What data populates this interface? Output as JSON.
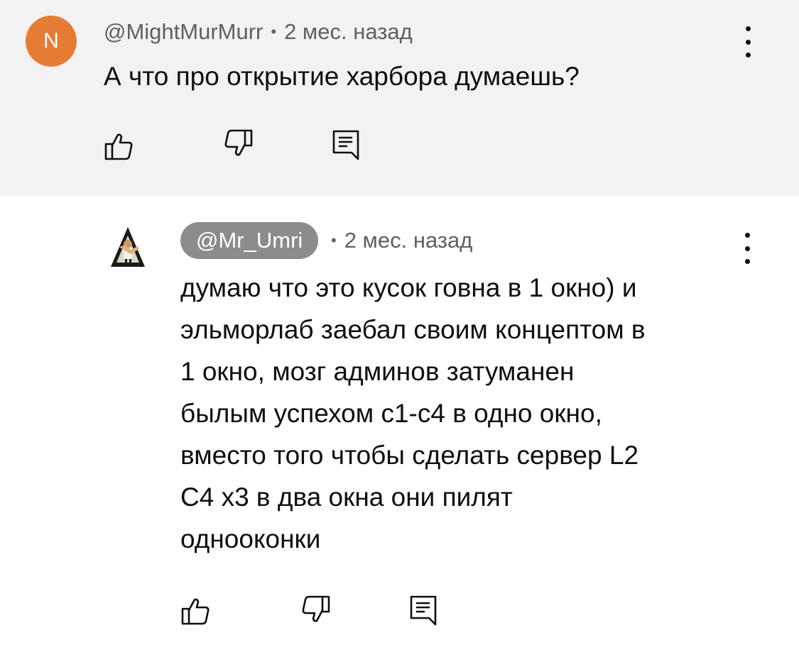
{
  "comments": [
    {
      "author": "@MightMurMurr",
      "avatar_letter": "N",
      "avatar_color": "#e57c35",
      "separator": "•",
      "time": "2 мес. назад",
      "text": "А что про открытие харбора думаешь?"
    },
    {
      "author": "@Mr_Umri",
      "author_chip_color": "#8c8c8c",
      "separator": "•",
      "time": "2 мес. назад",
      "text_lines": [
        "думаю что это кусок говна в 1 окно) и",
        "эльморлаб заебал своим концептом в",
        "1 окно, мозг админов затуманен",
        "былым успехом с1-с4 в одно окно,",
        "вместо того чтобы сделать сервер L2",
        "C4 x3 в два окна они пилят",
        "однооконки"
      ]
    }
  ],
  "icons": {
    "like": "thumbs-up-icon",
    "dislike": "thumbs-down-icon",
    "reply": "reply-comment-icon",
    "menu": "more-vertical-icon"
  },
  "colors": {
    "highlight_background": "#f2f2f2",
    "meta_text": "#606060",
    "primary_text": "#0f0f0f"
  }
}
